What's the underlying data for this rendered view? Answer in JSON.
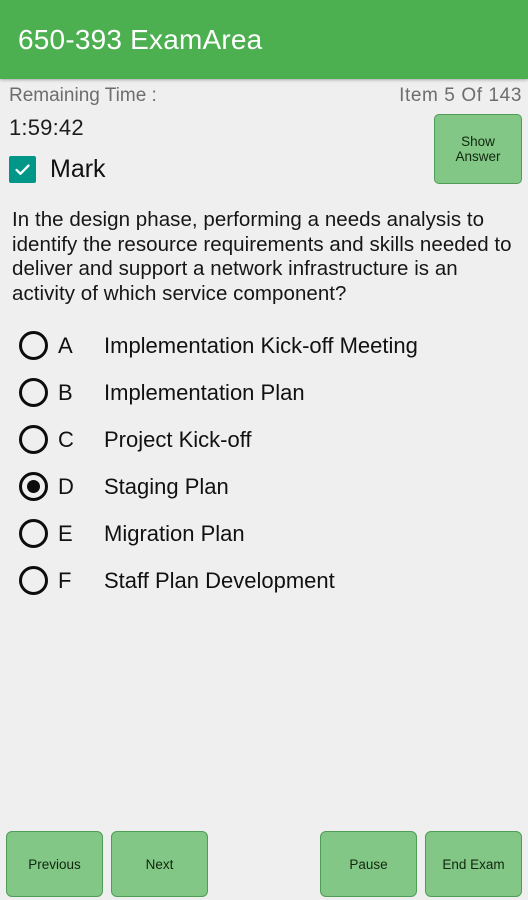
{
  "appbar": {
    "title": "650-393 ExamArea",
    "background_color": "#4CAF50",
    "title_color": "#FFFFFF"
  },
  "status": {
    "remaining_time_label": "Remaining Time :",
    "item_counter": "Item 5 Of 143",
    "current_item": 5,
    "total_items": 143
  },
  "timer": {
    "value": "1:59:42"
  },
  "mark": {
    "label": "Mark",
    "checked": true,
    "checkbox_color": "#009688",
    "check_glyph": "check-icon"
  },
  "show_answer": {
    "label": "Show Answer"
  },
  "question": {
    "text": "In the design phase, performing a needs analysis to identify the resource requirements and skills needed to deliver and support a network infrastructure is an activity of which service component?"
  },
  "options": [
    {
      "letter": "A",
      "text": "Implementation Kick-off Meeting",
      "selected": false
    },
    {
      "letter": "B",
      "text": "Implementation Plan",
      "selected": false
    },
    {
      "letter": "C",
      "text": "Project Kick-off",
      "selected": false
    },
    {
      "letter": "D",
      "text": "Staging Plan",
      "selected": true
    },
    {
      "letter": "E",
      "text": "Migration Plan",
      "selected": false
    },
    {
      "letter": "F",
      "text": "Staff Plan Development",
      "selected": false
    }
  ],
  "bottom_bar": {
    "previous_label": "Previous",
    "next_label": "Next",
    "pause_label": "Pause",
    "end_exam_label": "End Exam",
    "button_color": "#82C786",
    "button_border_color": "#4F9C57"
  },
  "theme": {
    "page_background": "#EFEFEF",
    "text_color": "#111111",
    "muted_text_color": "#6D6D6D"
  }
}
